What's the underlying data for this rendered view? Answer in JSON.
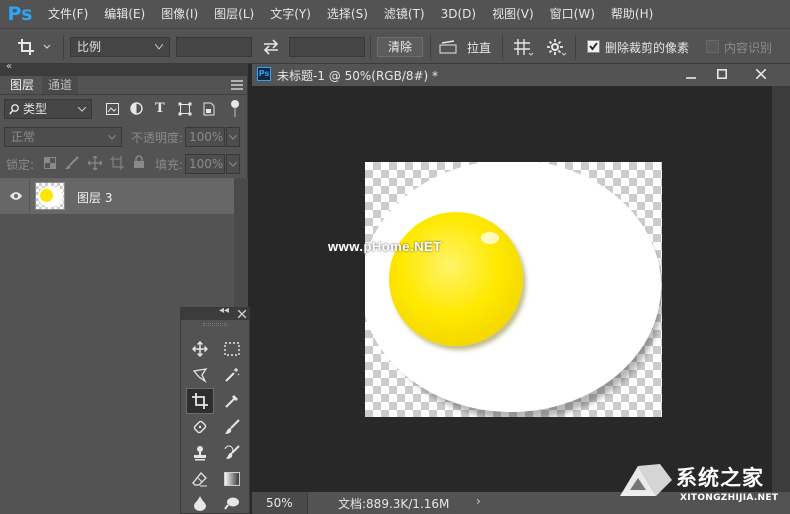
{
  "menubar": {
    "logo": "Ps",
    "items": [
      "文件(F)",
      "编辑(E)",
      "图像(I)",
      "图层(L)",
      "文字(Y)",
      "选择(S)",
      "滤镜(T)",
      "3D(D)",
      "视图(V)",
      "窗口(W)",
      "帮助(H)"
    ]
  },
  "options_bar": {
    "ratio_value": "比例",
    "clear_label": "清除",
    "straighten_label": "拉直",
    "delete_cropped_label": "删除裁剪的像素",
    "delete_cropped_checked": true,
    "content_aware_label": "内容识别",
    "content_aware_checked": false
  },
  "layers_panel": {
    "tabs": [
      "图层",
      "通道"
    ],
    "filter_kind": "类型",
    "blend_mode": "正常",
    "opacity_label": "不透明度:",
    "opacity_value": "100%",
    "lock_label": "锁定:",
    "fill_label": "填充:",
    "fill_value": "100%",
    "layers": [
      {
        "name": "图层 3",
        "visible": true
      }
    ]
  },
  "document": {
    "tab_title": "未标题-1 @ 50%(RGB/8#) *",
    "zoom": "50%",
    "doc_info": "文档:889.3K/1.16M",
    "watermark_text": "www.pHome.NET"
  },
  "site_watermark": {
    "name": "系统之家",
    "url": "XITONGZHIJIA.NET"
  },
  "colors": {
    "ui_panel": "#535353",
    "ui_dark": "#282828",
    "ps_blue": "#2fa3f5",
    "yolk": "#ffe600",
    "egg_white": "#ffffff"
  }
}
